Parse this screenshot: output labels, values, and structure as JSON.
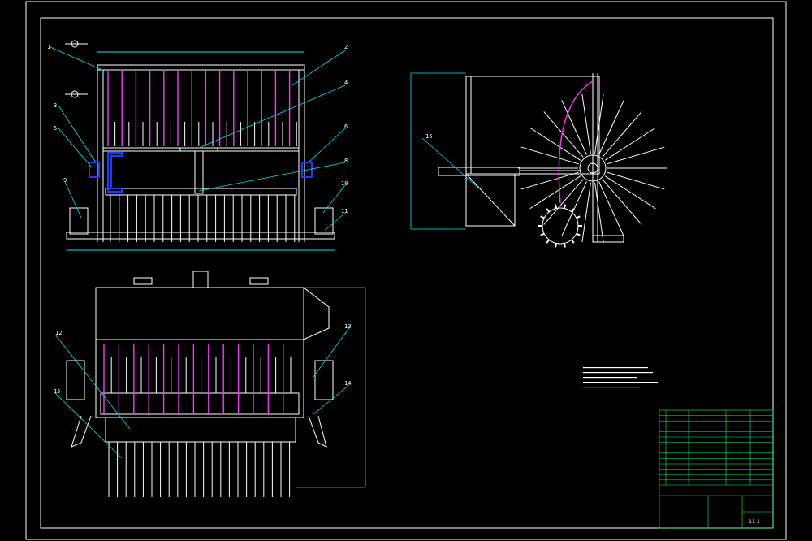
{
  "colors": {
    "background": "#000000",
    "outline": "#ffffff",
    "leader": "#00e5ff",
    "tine": "#ff33ff",
    "hidden": "#1a3cff",
    "title_grid": "#00ff66"
  },
  "part_numbers": [
    "1",
    "2",
    "3",
    "4",
    "5",
    "6",
    "8",
    "9",
    "10",
    "11",
    "12",
    "13",
    "14",
    "15",
    "16"
  ],
  "drawing_code": "-11-1"
}
